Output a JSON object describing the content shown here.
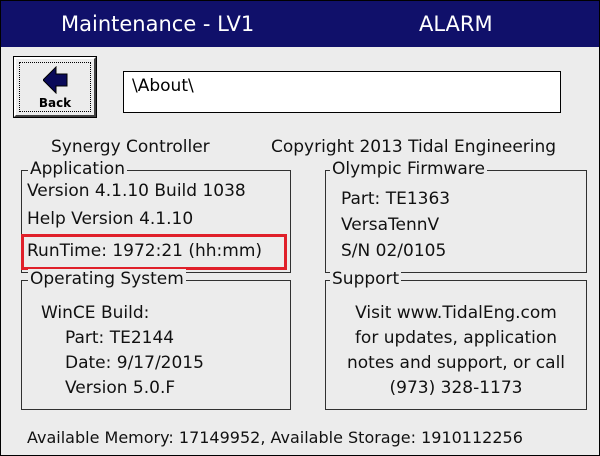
{
  "title_bar": {
    "title": "Maintenance - LV1",
    "status": "ALARM"
  },
  "back_button": {
    "label": "Back",
    "icon": "back-arrow-icon"
  },
  "path_field": {
    "value": "\\About\\"
  },
  "header": {
    "product": "Synergy Controller",
    "copyright": "Copyright 2013 Tidal Engineering"
  },
  "application": {
    "legend": "Application",
    "version": "Version 4.1.10 Build 1038",
    "help_version": "Help Version 4.1.10",
    "runtime": "RunTime: 1972:21 (hh:mm)"
  },
  "firmware": {
    "legend": "Olympic Firmware",
    "part": "Part: TE1363",
    "name": "VersaTennV",
    "serial": "S/N  02/0105"
  },
  "os": {
    "legend": "Operating System",
    "build": "WinCE Build:",
    "part": "Part: TE2144",
    "date": "Date: 9/17/2015",
    "version": "Version 5.0.F"
  },
  "support": {
    "legend": "Support",
    "line1": "Visit www.TidalEng.com",
    "line2": "for updates, application",
    "line3": "notes and support, or call",
    "line4": "(973) 328-1173"
  },
  "footer": {
    "memory": "Available Memory: 17149952, Available Storage: 1910112256"
  },
  "colors": {
    "title_bar": "#10106a",
    "highlight": "#e0202a",
    "panel": "#ececec"
  }
}
